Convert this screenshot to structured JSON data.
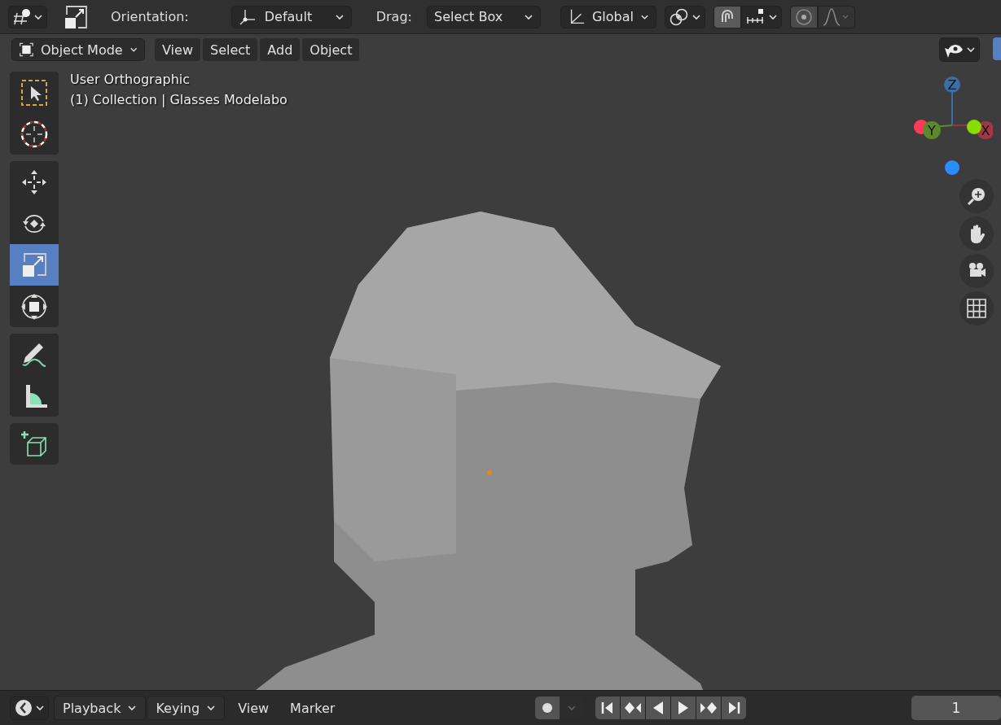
{
  "top_bar": {
    "orientation_label": "Orientation:",
    "orientation": "Default",
    "drag_label": "Drag:",
    "drag": "Select Box",
    "transform": "Global",
    "snap": {
      "on": true
    },
    "proportional": {
      "on": false
    }
  },
  "viewport_header": {
    "mode": "Object Mode",
    "menus": [
      "View",
      "Select",
      "Add",
      "Object"
    ]
  },
  "viewport": {
    "view_name": "User Orthographic",
    "collection": "(1) Collection | Glasses Modelabo",
    "tool_groups": [
      [
        {
          "kind": "select",
          "selected": false
        },
        {
          "kind": "cursor",
          "selected": false
        }
      ],
      [
        {
          "kind": "move",
          "selected": false
        },
        {
          "kind": "rotate",
          "selected": false
        },
        {
          "kind": "scale",
          "selected": true
        },
        {
          "kind": "transform",
          "selected": false
        }
      ],
      [
        {
          "kind": "annotate",
          "selected": false
        },
        {
          "kind": "measure",
          "selected": false
        }
      ],
      [
        {
          "kind": "add",
          "selected": false
        }
      ]
    ],
    "gizmo": {
      "z": "Z",
      "y": "Y",
      "x": "X"
    }
  },
  "timeline": {
    "menus": [
      {
        "label": "Playback",
        "dropdown": true
      },
      {
        "label": "Keying",
        "dropdown": true
      },
      {
        "label": "View",
        "dropdown": false
      },
      {
        "label": "Marker",
        "dropdown": false
      }
    ],
    "frame": "1"
  }
}
